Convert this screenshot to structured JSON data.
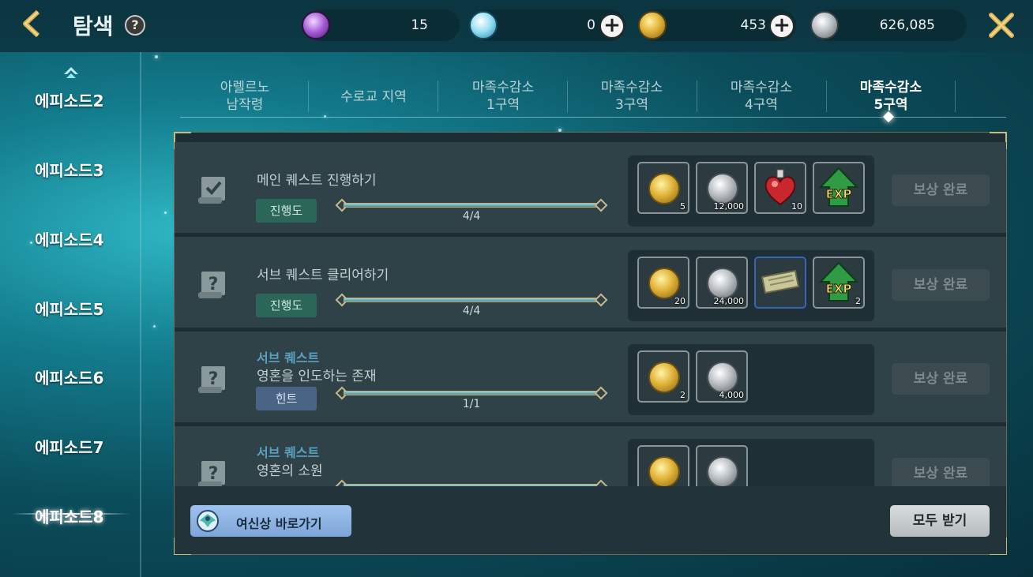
{
  "header": {
    "title": "탐색",
    "help": "?",
    "currencies": [
      {
        "icon": "purple-gem-icon",
        "value": "15"
      },
      {
        "icon": "blue-crystal-icon",
        "value": "0"
      },
      {
        "icon": "gold-coin-icon",
        "value": "453"
      },
      {
        "icon": "silver-coin-icon",
        "value": "626,085"
      }
    ]
  },
  "sidebar": {
    "items": [
      {
        "label": "에피소드2"
      },
      {
        "label": "에피소드3"
      },
      {
        "label": "에피소드4"
      },
      {
        "label": "에피소드5"
      },
      {
        "label": "에피소드6"
      },
      {
        "label": "에피소드7"
      },
      {
        "label": "에피소드8",
        "active": true
      }
    ]
  },
  "tabs": [
    {
      "line1": "아렐르노",
      "line2": "남작령"
    },
    {
      "line1": "수로교 지역",
      "line2": ""
    },
    {
      "line1": "마족수감소",
      "line2": "1구역"
    },
    {
      "line1": "마족수감소",
      "line2": "3구역"
    },
    {
      "line1": "마족수감소",
      "line2": "4구역"
    },
    {
      "line1": "마족수감소",
      "line2": "5구역",
      "active": true
    }
  ],
  "quests": [
    {
      "subtitle": "",
      "title": "메인 퀘스트 진행하기",
      "badge": "진행도",
      "progress_text": "4/4",
      "progress": 1.0,
      "rewards": [
        {
          "icon": "gold-coin-icon",
          "qty": "5"
        },
        {
          "icon": "silver-coin-icon",
          "qty": "12,000"
        },
        {
          "icon": "heart-potion-icon",
          "qty": "10"
        },
        {
          "icon": "exp-icon",
          "qty": ""
        }
      ],
      "claim_label": "보상 완료"
    },
    {
      "subtitle": "",
      "title": "서브 퀘스트 클리어하기",
      "badge": "진행도",
      "progress_text": "4/4",
      "progress": 1.0,
      "rewards": [
        {
          "icon": "gold-coin-icon",
          "qty": "20"
        },
        {
          "icon": "silver-coin-icon",
          "qty": "24,000"
        },
        {
          "icon": "scroll-ticket-icon",
          "qty": ""
        },
        {
          "icon": "exp-icon",
          "qty": "2"
        }
      ],
      "claim_label": "보상 완료"
    },
    {
      "subtitle": "서브 퀘스트",
      "title": "영혼을 인도하는 존재",
      "badge": "힌트",
      "progress_text": "1/1",
      "progress": 1.0,
      "rewards": [
        {
          "icon": "gold-coin-icon",
          "qty": "2"
        },
        {
          "icon": "silver-coin-icon",
          "qty": "4,000"
        }
      ],
      "claim_label": "보상 완료"
    },
    {
      "subtitle": "서브 퀘스트",
      "title": "영혼의 소원",
      "badge": "",
      "progress_text": "",
      "progress": 1.0,
      "rewards": [
        {
          "icon": "gold-coin-icon",
          "qty": ""
        },
        {
          "icon": "silver-coin-icon",
          "qty": ""
        }
      ],
      "claim_label": "보상 완료"
    }
  ],
  "footer": {
    "goddess_label": "여신상 바로가기",
    "claim_all_label": "모두 받기"
  }
}
